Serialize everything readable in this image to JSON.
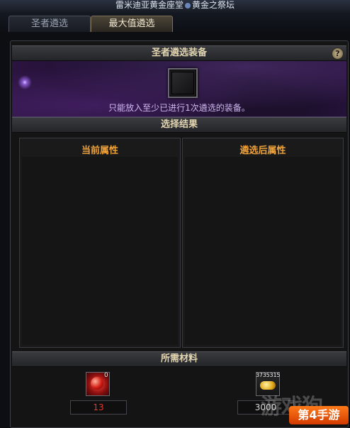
{
  "window": {
    "title_left": "雷米迪亚黄金座堂",
    "title_right": "黄金之祭坛"
  },
  "tabs": [
    {
      "label": "圣者遴选",
      "active": false
    },
    {
      "label": "最大值遴选",
      "active": true
    }
  ],
  "equip_section": {
    "header": "圣者遴选装备",
    "help_label": "?",
    "hint": "只能放入至少已进行1次遴选的装备。"
  },
  "result_section": {
    "header": "选择结果",
    "current_label": "当前属性",
    "after_label": "遴选后属性"
  },
  "materials_section": {
    "header": "所需材料",
    "items": [
      {
        "icon": "red-orb-icon",
        "badge": "0",
        "required": "13"
      },
      {
        "icon": "gold-coins-icon",
        "badge": "3735315",
        "required": "3000"
      }
    ]
  },
  "watermark": "游戏狗",
  "logo_text": "第4手游",
  "colors": {
    "accent": "#f0a33a",
    "hint": "#cfb8f0",
    "required_red": "#e23a2a"
  }
}
